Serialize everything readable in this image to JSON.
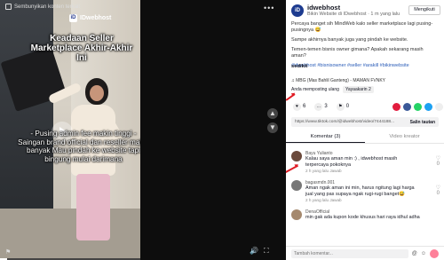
{
  "video": {
    "top_note": "Sembunyikan konten terkait",
    "brand": "IDwebhost",
    "brand_logo": "iD",
    "headline": "Keadaan Seller Marketplace Akhir-Akhir Ini",
    "caption": "- Pusing admin fee makin tinggi - Saingan brand official dan reseller makin banyak Mau pindah ke website tapi bingung mulai darimana",
    "more_dots": "•••",
    "progress": 0.05
  },
  "panel": {
    "author_name": "idwebhost",
    "author_sub": "Bikin Website di IDwebhost · 1 m yang lalu",
    "follow_label": "Mengikuti",
    "desc_lines": [
      "Percaya banget sih MindWeb kalo seller marketplace lagi pusing-pusingnya 😅",
      "Sampe akhirnya banyak juga yang pindah ke website.",
      "Temen-temen bisnis owner gimana? Apakah sekarang masih aman?"
    ],
    "hashtags": "#idwebhost #bisnisowner #seller #arakill #bikinwebsite",
    "more_label": "sedikit",
    "music": "♫ MBG (Mas Bahlil Ganteng) - MAMAN FVNKY",
    "viewer_text": "Anda memposting ulang",
    "viewer_chip": "Yayaakarin",
    "viewer_count": "2",
    "stats": {
      "likes": "6",
      "comments": "3",
      "saves": "0"
    },
    "link": "https://www.tiktok.com/@idwebhost/video/7444188...",
    "copy_link": "Salin tautan",
    "tabs": [
      "Komentar (3)",
      "Video kreator"
    ],
    "comments": [
      {
        "name": "Bayu Yulianto",
        "text": "Kalau saya aman min :) , idwebhost masih terpercaya pokoknya",
        "meta": "2 h yang lalu   Jawab",
        "likes": "0",
        "color": "#6b4a3c"
      },
      {
        "name": "bagasmdn.001",
        "text": "Aman ngak aman ini min, harus ngitung lagi harga jual yang pas supaya ngak rugi-rugi banget😅",
        "meta": "2 h yang lalu   Jawab",
        "likes": "0",
        "color": "#777777"
      },
      {
        "name": "DenaOfficial",
        "text": "min gak ada kupon kode khusus hari raya idhul adha",
        "meta": "",
        "likes": "",
        "color": "#a5896e"
      }
    ],
    "compose_placeholder": "Tambah komentar...",
    "compose_at": "@",
    "compose_emoji": "☺"
  }
}
